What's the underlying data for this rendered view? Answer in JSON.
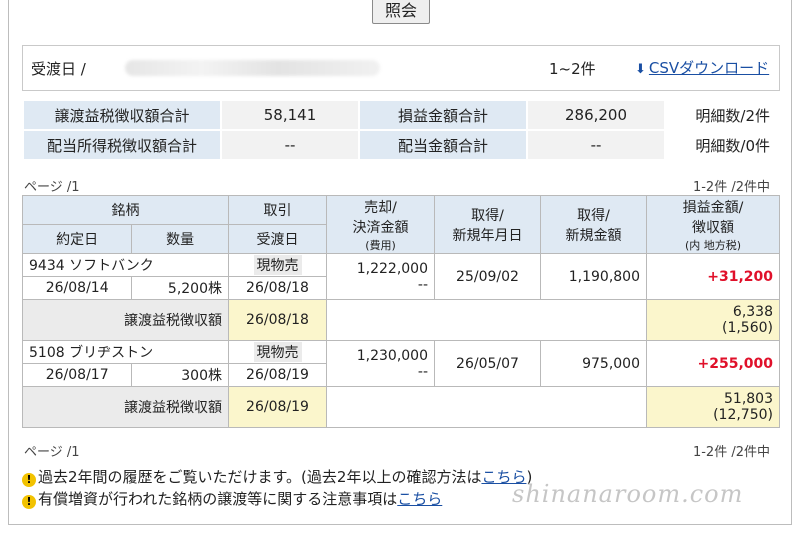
{
  "inquiry_button": "照会",
  "condition": {
    "label": "受渡日 /",
    "count": "1~2件",
    "csv_label": "CSVダウンロード"
  },
  "summary": {
    "row1": [
      "譲渡益税徴収額合計",
      "58,141",
      "損益金額合計",
      "286,200",
      "明細数/2件"
    ],
    "row2": [
      "配当所得税徴収額合計",
      "--",
      "配当金額合計",
      "--",
      "明細数/0件"
    ]
  },
  "pager": {
    "page": "ページ /1",
    "count": "1-2件 /2件中"
  },
  "table": {
    "headers": {
      "stock": "銘柄",
      "contract_date": "約定日",
      "quantity": "数量",
      "trade": "取引",
      "settle_date": "受渡日",
      "sell_1": "売却/",
      "sell_2": "決済金額",
      "sell_3": "(費用)",
      "acq_date_1": "取得/",
      "acq_date_2": "新規年月日",
      "acq_amt_1": "取得/",
      "acq_amt_2": "新規金額",
      "pl_1": "損益金額/",
      "pl_2": "徴収額",
      "pl_3": "(内 地方税)"
    },
    "rows": [
      {
        "name": "9434 ソフトバンク",
        "contract_date": "26/08/14",
        "quantity": "5,200株",
        "trade": "現物売",
        "settle_date": "26/08/18",
        "sell_amount": "1,222,000",
        "fee": "--",
        "acq_date": "25/09/02",
        "acq_amount": "1,190,800",
        "pl": "+31,200",
        "tax_label": "譲渡益税徴収額",
        "tax_date": "26/08/18",
        "tax": "6,338",
        "tax_local": "(1,560)"
      },
      {
        "name": "5108 ブリヂストン",
        "contract_date": "26/08/17",
        "quantity": "300株",
        "trade": "現物売",
        "settle_date": "26/08/19",
        "sell_amount": "1,230,000",
        "fee": "--",
        "acq_date": "26/05/07",
        "acq_amount": "975,000",
        "pl": "+255,000",
        "tax_label": "譲渡益税徴収額",
        "tax_date": "26/08/19",
        "tax": "51,803",
        "tax_local": "(12,750)"
      }
    ]
  },
  "notes": {
    "n1_text": "過去2年間の履歴をご覧いただけます。(過去2年以上の確認方法は",
    "n1_link": "こちら",
    "n1_tail": ")",
    "n2_text": "有償増資が行われた銘柄の譲渡等に関する注意事項は",
    "n2_link": "こちら"
  },
  "watermark": "shinanaroom.com"
}
